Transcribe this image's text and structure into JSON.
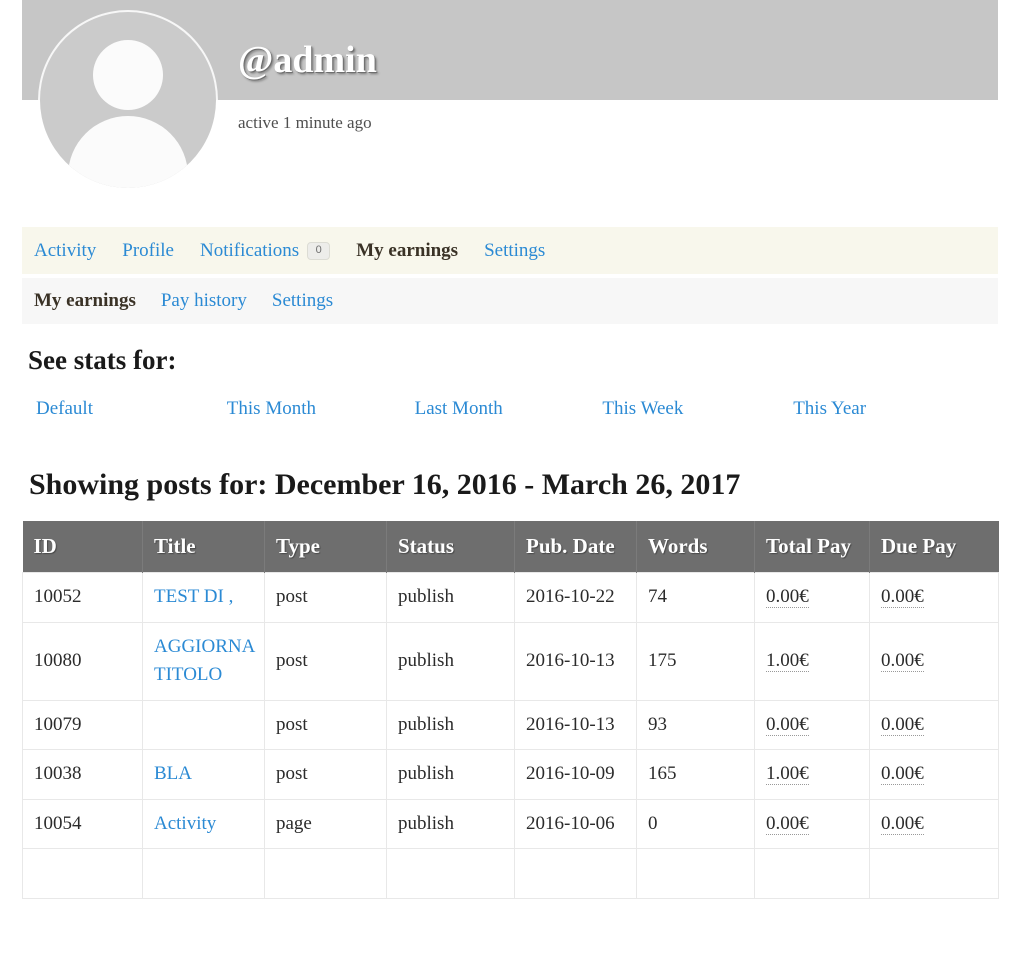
{
  "profile": {
    "handle": "@admin",
    "last_active": "active 1 minute ago",
    "avatar_icon": "default-user-silhouette-icon",
    "cover_color": "#c6c6c6"
  },
  "nav_primary": {
    "items": [
      {
        "label": "Activity",
        "active": false
      },
      {
        "label": "Profile",
        "active": false
      },
      {
        "label": "Notifications",
        "active": false,
        "badge": "0"
      },
      {
        "label": "My earnings",
        "active": true
      },
      {
        "label": "Settings",
        "active": false
      }
    ]
  },
  "nav_sub": {
    "items": [
      {
        "label": "My earnings",
        "active": true
      },
      {
        "label": "Pay history",
        "active": false
      },
      {
        "label": "Settings",
        "active": false
      }
    ]
  },
  "stats": {
    "heading": "See stats for:",
    "filters": [
      {
        "label": "Default"
      },
      {
        "label": "This Month"
      },
      {
        "label": "Last Month"
      },
      {
        "label": "This Week"
      },
      {
        "label": "This Year"
      }
    ]
  },
  "showing": {
    "heading": "Showing posts for: December 16, 2016 - March 26, 2017"
  },
  "table": {
    "columns": [
      "ID",
      "Title",
      "Type",
      "Status",
      "Pub. Date",
      "Words",
      "Total Pay",
      "Due Pay"
    ],
    "rows": [
      {
        "id": "10052",
        "title": "TEST DI ,",
        "type": "post",
        "status": "publish",
        "pub_date": "2016-10-22",
        "words": "74",
        "total_pay": "0.00€",
        "due_pay": "0.00€"
      },
      {
        "id": "10080",
        "title": "AGGIORNA TITOLO",
        "type": "post",
        "status": "publish",
        "pub_date": "2016-10-13",
        "words": "175",
        "total_pay": "1.00€",
        "due_pay": "0.00€"
      },
      {
        "id": "10079",
        "title": "",
        "type": "post",
        "status": "publish",
        "pub_date": "2016-10-13",
        "words": "93",
        "total_pay": "0.00€",
        "due_pay": "0.00€"
      },
      {
        "id": "10038",
        "title": "BLA",
        "type": "post",
        "status": "publish",
        "pub_date": "2016-10-09",
        "words": "165",
        "total_pay": "1.00€",
        "due_pay": "0.00€"
      },
      {
        "id": "10054",
        "title": "Activity",
        "type": "page",
        "status": "publish",
        "pub_date": "2016-10-06",
        "words": "0",
        "total_pay": "0.00€",
        "due_pay": "0.00€"
      }
    ]
  },
  "colors": {
    "link": "#2b8ad4",
    "nav_primary_bg": "#f8f7ec",
    "nav_sub_bg": "#f7f7f7",
    "table_header_bg": "#6e6e6e"
  }
}
